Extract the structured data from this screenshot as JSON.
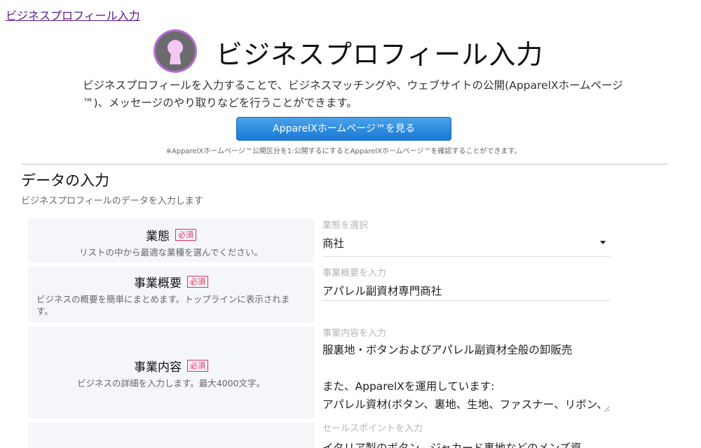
{
  "breadcrumb": {
    "link": "ビジネスプロフィール入力"
  },
  "hero": {
    "title": "ビジネスプロフィール入力",
    "logo_icon": "keyhole-icon",
    "logo_ring_color": "#b56cd6"
  },
  "intro": "ビジネスプロフィールを入力することで、ビジネスマッチングや、ウェブサイトの公開(ApparelXホームページ™)、メッセージのやり取りなどを行うことができます。",
  "home_button": {
    "label": "ApparelXホームページ™を見る",
    "color": "#1a78d6"
  },
  "note": "※ApparelXホームページ™公開区分を1:公開するにするとApparelXホームページ™を確認することができます。",
  "section": {
    "title": "データの入力",
    "subtitle": "ビジネスプロフィールのデータを入力します"
  },
  "required_label": "必須",
  "fields": {
    "business_type": {
      "label": "業態",
      "description": "リストの中から最適な業種を選んでください。",
      "hint": "業態を選択",
      "value": "商社"
    },
    "summary": {
      "label": "事業概要",
      "description": "ビジネスの概要を簡単にまとめます。トップラインに表示されます。",
      "hint": "事業概要を入力",
      "value": "アパレル副資材専門商社"
    },
    "details": {
      "label": "事業内容",
      "description": "ビジネスの詳細を入力します。最大4000文字。",
      "hint": "事業内容を入力",
      "value": "服裏地・ボタンおよびアパレル副資材全般の卸販売\n\nまた、ApparelXを運用しています:\nアパレル資材(ボタン、裏地、生地、ファスナー、リボン、レース、タグなどの金属パーツ、スナップ、シーチング等"
    },
    "sales_point": {
      "hint": "セールスポイントを入力",
      "value": "イタリア製のボタン、ジャカード裏地などのメンズ資"
    }
  }
}
